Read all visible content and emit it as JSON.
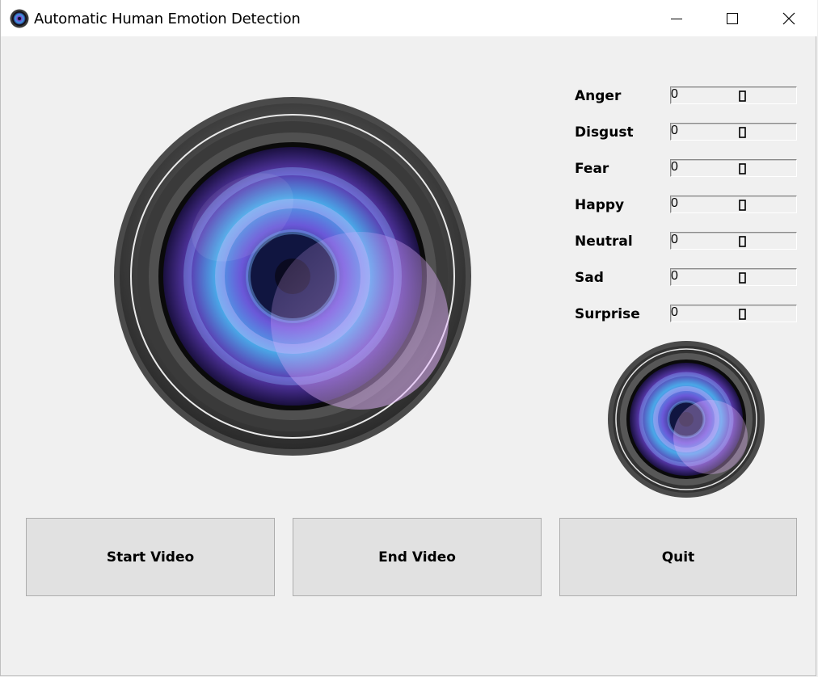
{
  "window": {
    "title": "Automatic Human Emotion Detection",
    "app_icon": "camera-lens-icon",
    "controls": [
      "minimize-icon",
      "maximize-icon",
      "close-icon"
    ]
  },
  "video_display": {
    "placeholder_icon": "camera-lens-icon"
  },
  "emotions": [
    {
      "label": "Anger",
      "value": "0"
    },
    {
      "label": "Disgust",
      "value": "0"
    },
    {
      "label": "Fear",
      "value": "0"
    },
    {
      "label": "Happy",
      "value": "0"
    },
    {
      "label": "Neutral",
      "value": "0"
    },
    {
      "label": "Sad",
      "value": "0"
    },
    {
      "label": "Surprise",
      "value": "0"
    }
  ],
  "emotion_display": {
    "placeholder_icon": "camera-lens-icon"
  },
  "buttons": {
    "start": "Start Video",
    "end": "End Video",
    "quit": "Quit"
  }
}
